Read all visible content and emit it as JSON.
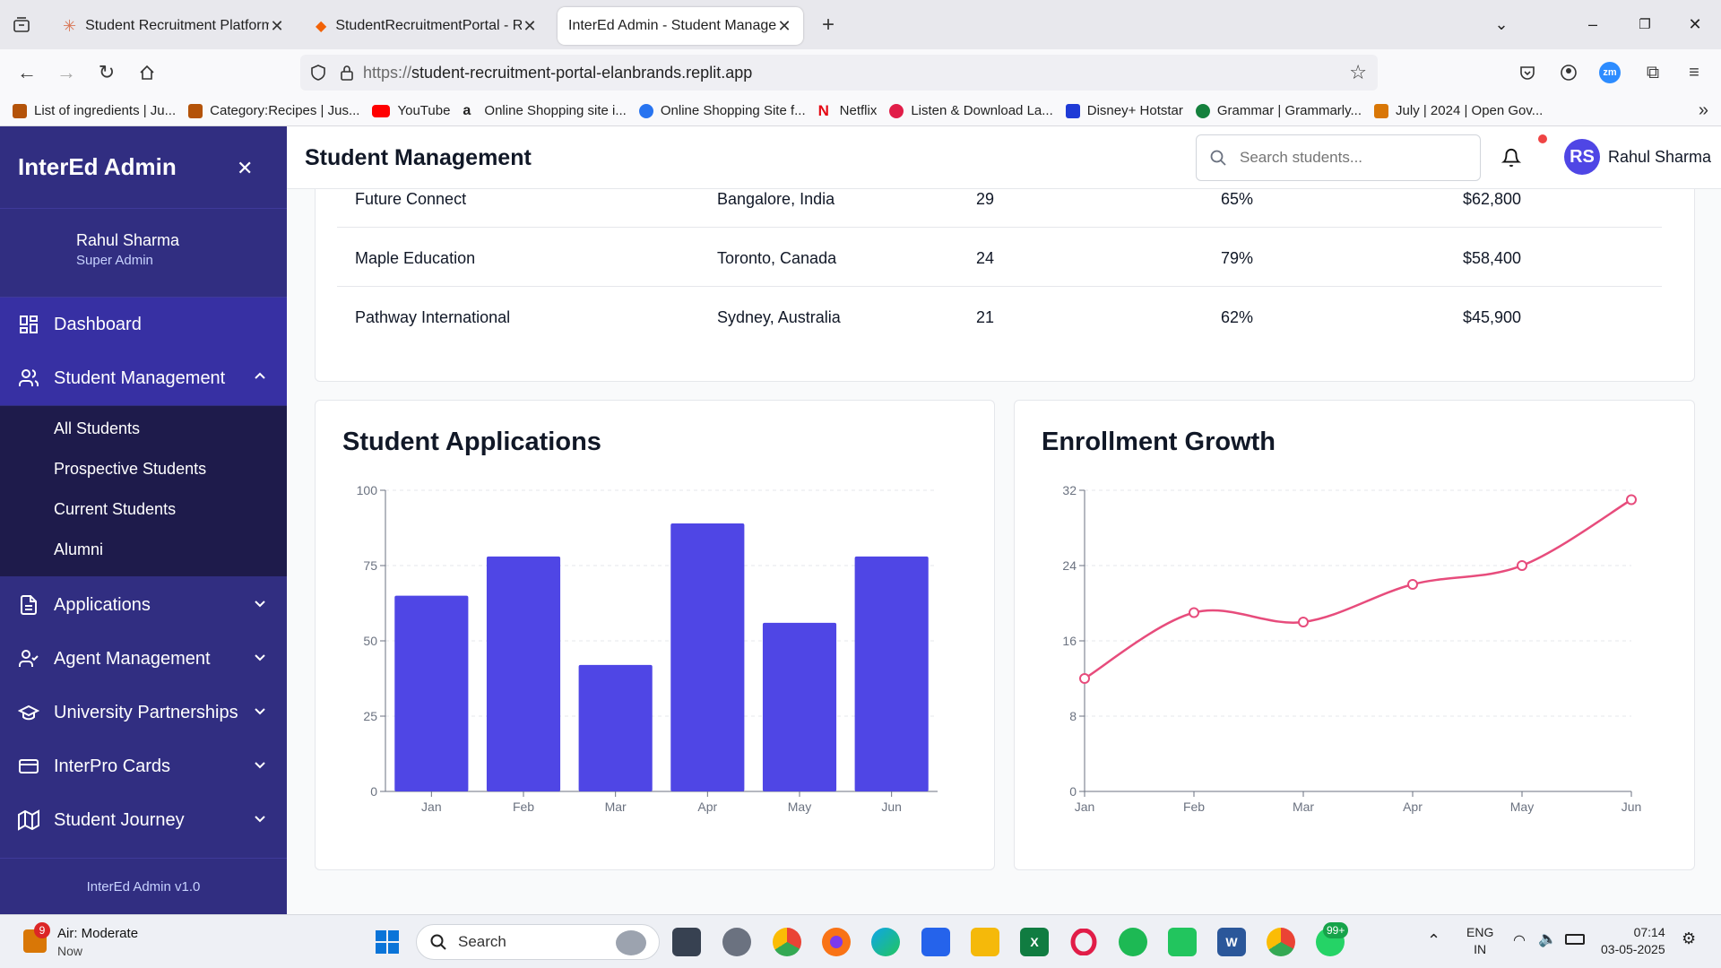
{
  "browser": {
    "tabs": [
      {
        "title": "Student Recruitment Platform D",
        "active": false
      },
      {
        "title": "StudentRecruitmentPortal - Rep",
        "active": false
      },
      {
        "title": "InterEd Admin - Student Manageme",
        "active": true
      }
    ],
    "url_protocol": "https://",
    "url_host": "student-recruitment-portal-elanbrands.replit.app",
    "bookmarks": [
      {
        "label": "List of ingredients | Ju...",
        "color": "#b45309"
      },
      {
        "label": "Category:Recipes | Jus...",
        "color": "#b45309"
      },
      {
        "label": "YouTube",
        "color": "#ff0000"
      },
      {
        "label": "Online Shopping site i...",
        "color": "#111111"
      },
      {
        "label": "Online Shopping Site f...",
        "color": "#f5c518"
      },
      {
        "label": "Netflix",
        "color": "#e50914"
      },
      {
        "label": "Listen & Download La...",
        "color": "#e11d48"
      },
      {
        "label": "Disney+ Hotstar",
        "color": "#1f3bd6"
      },
      {
        "label": "Grammar | Grammarly...",
        "color": "#15803d"
      },
      {
        "label": "July | 2024 | Open Gov...",
        "color": "#d97706"
      }
    ]
  },
  "sidebar": {
    "brand": "InterEd Admin",
    "user_name": "Rahul Sharma",
    "user_role": "Super Admin",
    "items": [
      {
        "label": "Dashboard",
        "icon": "grid-icon"
      },
      {
        "label": "Student Management",
        "icon": "users-icon"
      },
      {
        "label": "Applications",
        "icon": "document-icon"
      },
      {
        "label": "Agent Management",
        "icon": "user-check-icon"
      },
      {
        "label": "University Partnerships",
        "icon": "graduation-cap-icon"
      },
      {
        "label": "InterPro Cards",
        "icon": "credit-card-icon"
      },
      {
        "label": "Student Journey",
        "icon": "map-icon"
      }
    ],
    "submenu": [
      "All Students",
      "Prospective Students",
      "Current Students",
      "Alumni"
    ],
    "version": "InterEd Admin v1.0"
  },
  "header": {
    "title": "Student Management",
    "search_placeholder": "Search students...",
    "avatar_initials": "RS",
    "user_name": "Rahul Sharma"
  },
  "table": {
    "rows": [
      [
        "Future Connect",
        "Bangalore, India",
        "29",
        "65%",
        "$62,800"
      ],
      [
        "Maple Education",
        "Toronto, Canada",
        "24",
        "79%",
        "$58,400"
      ],
      [
        "Pathway International",
        "Sydney, Australia",
        "21",
        "62%",
        "$45,900"
      ]
    ]
  },
  "chart_data": [
    {
      "type": "bar",
      "title": "Student Applications",
      "categories": [
        "Jan",
        "Feb",
        "Mar",
        "Apr",
        "May",
        "Jun"
      ],
      "values": [
        65,
        78,
        42,
        89,
        56,
        78
      ],
      "ylim": [
        0,
        100
      ],
      "yticks": [
        0,
        25,
        50,
        75,
        100
      ],
      "color": "#4f46e5",
      "grid": true
    },
    {
      "type": "line",
      "title": "Enrollment Growth",
      "categories": [
        "Jan",
        "Feb",
        "Mar",
        "Apr",
        "May",
        "Jun"
      ],
      "values": [
        12,
        19,
        18,
        22,
        24,
        31
      ],
      "ylim": [
        0,
        32
      ],
      "yticks": [
        0,
        8,
        16,
        24,
        32
      ],
      "color": "#e74c7c",
      "grid": true
    }
  ],
  "taskbar": {
    "weather_badge": "9",
    "weather_title": "Air: Moderate",
    "weather_sub": "Now",
    "search_label": "Search",
    "whatsapp_badge": "99+",
    "lang": "ENG",
    "region": "IN",
    "time": "07:14",
    "date": "03-05-2025"
  }
}
